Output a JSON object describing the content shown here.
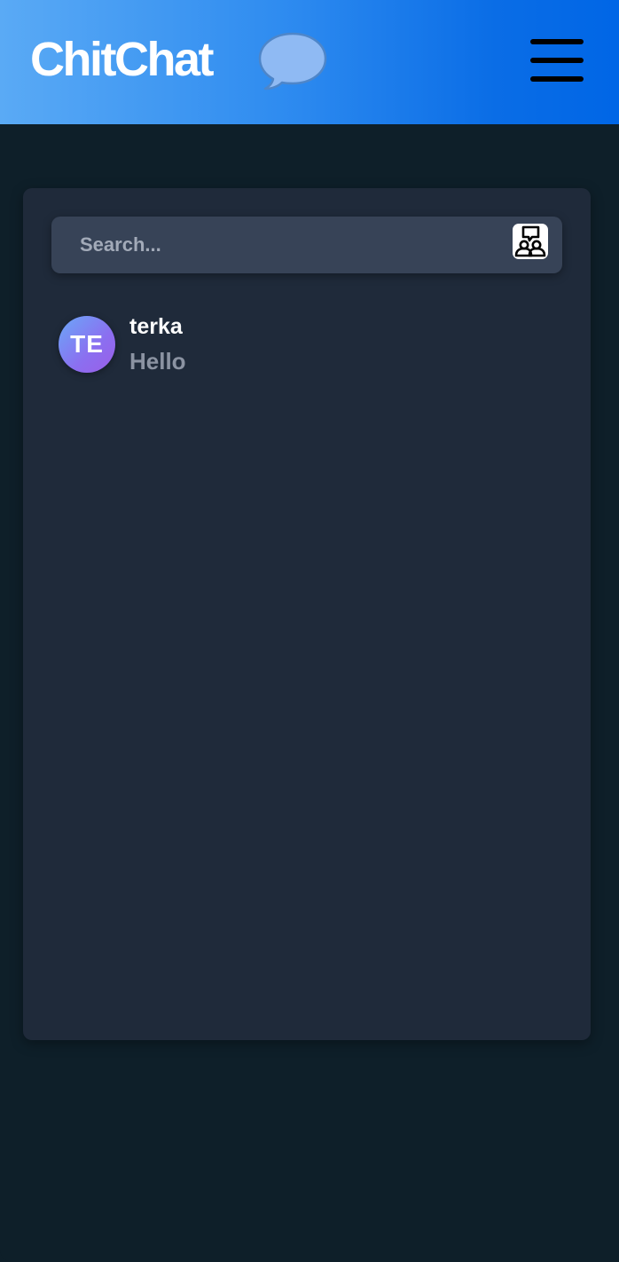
{
  "header": {
    "app_name": "ChitChat",
    "logo_icon": "speech-bubble-icon",
    "menu_icon": "hamburger-menu-icon"
  },
  "search": {
    "placeholder": "Search...",
    "value": "",
    "action_icon": "new-group-chat-icon"
  },
  "contacts": [
    {
      "initials": "TE",
      "name": "terka",
      "last_message": "Hello"
    }
  ],
  "colors": {
    "header_gradient_start": "#5aaaf5",
    "header_gradient_end": "#0066e6",
    "background": "#0e1f29",
    "panel": "#1f2a3a",
    "search_field": "#374357",
    "avatar_gradient_start": "#6aa8f8",
    "avatar_gradient_end": "#9b5ee8",
    "secondary_text": "#8b93a2"
  }
}
